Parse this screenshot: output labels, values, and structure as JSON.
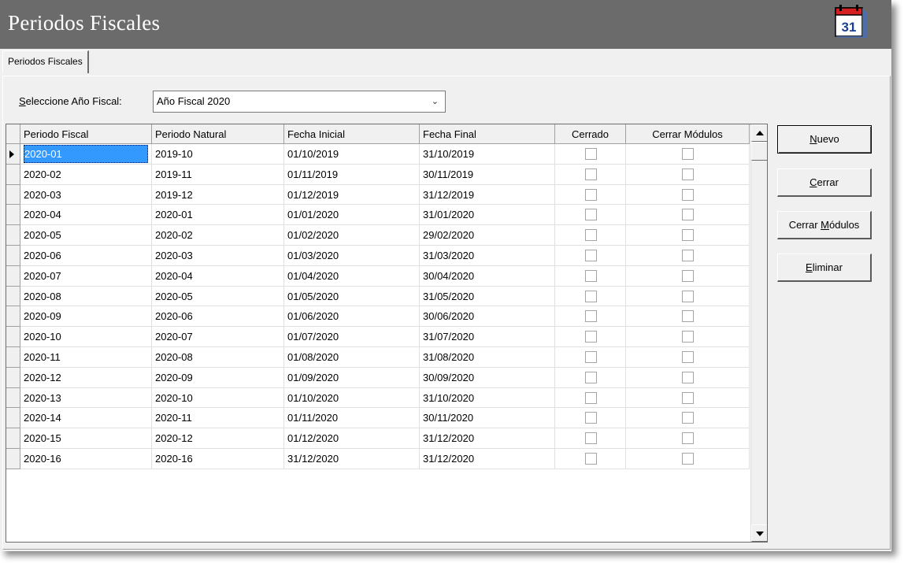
{
  "window": {
    "title": "Periodos Fiscales"
  },
  "tabs": [
    {
      "label": "Periodos Fiscales"
    }
  ],
  "year_selector": {
    "label_prefix": "S",
    "label_rest": "eleccione Año Fiscal:",
    "value": "Año Fiscal 2020"
  },
  "grid": {
    "columns": [
      "Periodo Fiscal",
      "Periodo Natural",
      "Fecha Inicial",
      "Fecha Final",
      "Cerrado",
      "Cerrar Módulos"
    ],
    "rows": [
      {
        "periodo_fiscal": "2020-01",
        "periodo_natural": "2019-10",
        "fecha_inicial": "01/10/2019",
        "fecha_final": "31/10/2019",
        "cerrado": false,
        "cerrar_modulos": false
      },
      {
        "periodo_fiscal": "2020-02",
        "periodo_natural": "2019-11",
        "fecha_inicial": "01/11/2019",
        "fecha_final": "30/11/2019",
        "cerrado": false,
        "cerrar_modulos": false
      },
      {
        "periodo_fiscal": "2020-03",
        "periodo_natural": "2019-12",
        "fecha_inicial": "01/12/2019",
        "fecha_final": "31/12/2019",
        "cerrado": false,
        "cerrar_modulos": false
      },
      {
        "periodo_fiscal": "2020-04",
        "periodo_natural": "2020-01",
        "fecha_inicial": "01/01/2020",
        "fecha_final": "31/01/2020",
        "cerrado": false,
        "cerrar_modulos": false
      },
      {
        "periodo_fiscal": "2020-05",
        "periodo_natural": "2020-02",
        "fecha_inicial": "01/02/2020",
        "fecha_final": "29/02/2020",
        "cerrado": false,
        "cerrar_modulos": false
      },
      {
        "periodo_fiscal": "2020-06",
        "periodo_natural": "2020-03",
        "fecha_inicial": "01/03/2020",
        "fecha_final": "31/03/2020",
        "cerrado": false,
        "cerrar_modulos": false
      },
      {
        "periodo_fiscal": "2020-07",
        "periodo_natural": "2020-04",
        "fecha_inicial": "01/04/2020",
        "fecha_final": "30/04/2020",
        "cerrado": false,
        "cerrar_modulos": false
      },
      {
        "periodo_fiscal": "2020-08",
        "periodo_natural": "2020-05",
        "fecha_inicial": "01/05/2020",
        "fecha_final": "31/05/2020",
        "cerrado": false,
        "cerrar_modulos": false
      },
      {
        "periodo_fiscal": "2020-09",
        "periodo_natural": "2020-06",
        "fecha_inicial": "01/06/2020",
        "fecha_final": "30/06/2020",
        "cerrado": false,
        "cerrar_modulos": false
      },
      {
        "periodo_fiscal": "2020-10",
        "periodo_natural": "2020-07",
        "fecha_inicial": "01/07/2020",
        "fecha_final": "31/07/2020",
        "cerrado": false,
        "cerrar_modulos": false
      },
      {
        "periodo_fiscal": "2020-11",
        "periodo_natural": "2020-08",
        "fecha_inicial": "01/08/2020",
        "fecha_final": "31/08/2020",
        "cerrado": false,
        "cerrar_modulos": false
      },
      {
        "periodo_fiscal": "2020-12",
        "periodo_natural": "2020-09",
        "fecha_inicial": "01/09/2020",
        "fecha_final": "30/09/2020",
        "cerrado": false,
        "cerrar_modulos": false
      },
      {
        "periodo_fiscal": "2020-13",
        "periodo_natural": "2020-10",
        "fecha_inicial": "01/10/2020",
        "fecha_final": "31/10/2020",
        "cerrado": false,
        "cerrar_modulos": false
      },
      {
        "periodo_fiscal": "2020-14",
        "periodo_natural": "2020-11",
        "fecha_inicial": "01/11/2020",
        "fecha_final": "30/11/2020",
        "cerrado": false,
        "cerrar_modulos": false
      },
      {
        "periodo_fiscal": "2020-15",
        "periodo_natural": "2020-12",
        "fecha_inicial": "01/12/2020",
        "fecha_final": "31/12/2020",
        "cerrado": false,
        "cerrar_modulos": false
      },
      {
        "periodo_fiscal": "2020-16",
        "periodo_natural": "2020-16",
        "fecha_inicial": "31/12/2020",
        "fecha_final": "31/12/2020",
        "cerrado": false,
        "cerrar_modulos": false
      }
    ],
    "selected_row": 0
  },
  "buttons": [
    {
      "key": "N",
      "rest": "uevo",
      "pre": ""
    },
    {
      "key": "C",
      "rest": "errar",
      "pre": ""
    },
    {
      "key": "M",
      "rest": "ódulos",
      "pre": "Cerrar "
    },
    {
      "key": "E",
      "rest": "liminar",
      "pre": ""
    }
  ],
  "icons": {
    "title_icon": "calendar-icon",
    "calendar_day": "31"
  },
  "colors": {
    "titlebar": "#6b6b6b",
    "selection": "#3399ff"
  }
}
